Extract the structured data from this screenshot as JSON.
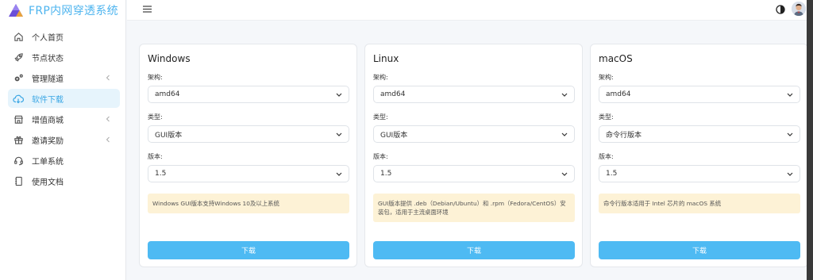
{
  "app": {
    "title": "FRP内网穿透系统",
    "accent_color": "#4db4ef"
  },
  "sidebar": {
    "items": [
      {
        "label": "个人首页",
        "icon": "home-icon",
        "active": false,
        "has_arrow": false
      },
      {
        "label": "节点状态",
        "icon": "rocket-icon",
        "active": false,
        "has_arrow": false
      },
      {
        "label": "管理隧道",
        "icon": "gears-icon",
        "active": false,
        "has_arrow": true
      },
      {
        "label": "软件下载",
        "icon": "cloud-download-icon",
        "active": true,
        "has_arrow": false
      },
      {
        "label": "增值商城",
        "icon": "shop-icon",
        "active": false,
        "has_arrow": true
      },
      {
        "label": "邀请奖励",
        "icon": "gift-icon",
        "active": false,
        "has_arrow": true
      },
      {
        "label": "工单系统",
        "icon": "headset-icon",
        "active": false,
        "has_arrow": false
      },
      {
        "label": "使用文档",
        "icon": "document-icon",
        "active": false,
        "has_arrow": false
      }
    ]
  },
  "header": {
    "menu_icon": "hamburger-icon",
    "theme_icon": "theme-toggle-icon",
    "avatar_icon": "user-avatar"
  },
  "cards": [
    {
      "title": "Windows",
      "arch_label": "架构:",
      "arch_value": "amd64",
      "type_label": "类型:",
      "type_value": "GUI版本",
      "version_label": "版本:",
      "version_value": "1.5",
      "notice": "Windows GUI版本支持Windows 10及以上系统",
      "download_label": "下载"
    },
    {
      "title": "Linux",
      "arch_label": "架构:",
      "arch_value": "amd64",
      "type_label": "类型:",
      "type_value": "GUI版本",
      "version_label": "版本:",
      "version_value": "1.5",
      "notice": "GUI版本提供 .deb（Debian/Ubuntu）和 .rpm（Fedora/CentOS）安装包，适用于主流桌面环境",
      "download_label": "下载"
    },
    {
      "title": "macOS",
      "arch_label": "架构:",
      "arch_value": "amd64",
      "type_label": "类型:",
      "type_value": "命令行版本",
      "version_label": "版本:",
      "version_value": "1.5",
      "notice": "命令行版本适用于 Intel 芯片的 macOS 系统",
      "download_label": "下载"
    }
  ]
}
